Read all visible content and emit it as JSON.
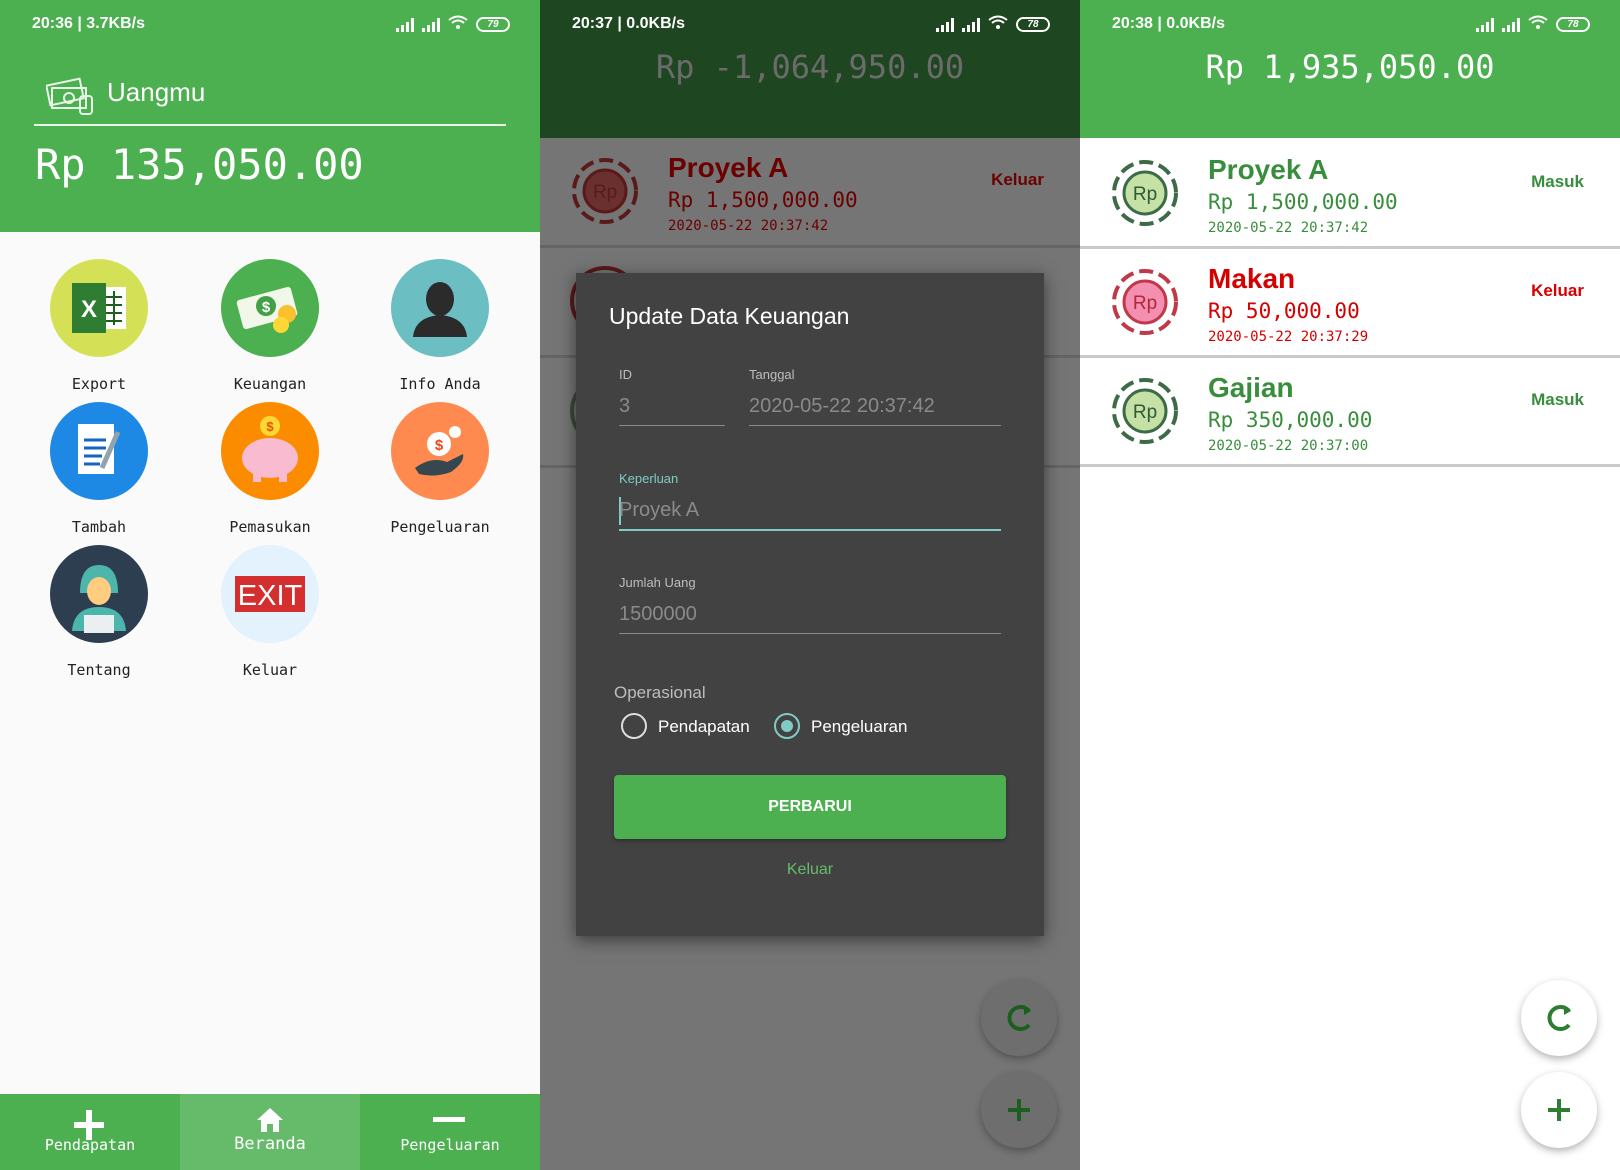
{
  "screen1": {
    "status": {
      "time": "20:36 | 3.7KB/s",
      "battery": "79"
    },
    "app_title": "Uangmu",
    "balance": "Rp 135,050.00",
    "menu": [
      {
        "label": "Export",
        "icon": "excel-icon"
      },
      {
        "label": "Keuangan",
        "icon": "money-icon"
      },
      {
        "label": "Info Anda",
        "icon": "user-icon"
      },
      {
        "label": "Tambah",
        "icon": "document-icon"
      },
      {
        "label": "Pemasukan",
        "icon": "piggy-bank-icon"
      },
      {
        "label": "Pengeluaran",
        "icon": "hand-coin-icon"
      },
      {
        "label": "Tentang",
        "icon": "developer-icon"
      },
      {
        "label": "Keluar",
        "icon": "exit-icon"
      }
    ],
    "bottom_nav": [
      {
        "label": "Pendapatan",
        "icon": "plus-icon"
      },
      {
        "label": "Beranda",
        "icon": "home-icon"
      },
      {
        "label": "Pengeluaran",
        "icon": "minus-icon"
      }
    ]
  },
  "screen2": {
    "status": {
      "time": "20:37 | 0.0KB/s",
      "battery": "78"
    },
    "total": "Rp -1,064,950.00",
    "row": {
      "name": "Proyek A",
      "amount": "Rp 1,500,000.00",
      "date": "2020-05-22 20:37:42",
      "type": "Keluar"
    },
    "dialog": {
      "title": "Update Data Keuangan",
      "id_label": "ID",
      "id_value": "3",
      "date_label": "Tanggal",
      "date_value": "2020-05-22 20:37:42",
      "purpose_label": "Keperluan",
      "purpose_value": "Proyek A",
      "amount_label": "Jumlah Uang",
      "amount_value": "1500000",
      "op_label": "Operasional",
      "op_options": [
        "Pendapatan",
        "Pengeluaran"
      ],
      "op_selected": "Pengeluaran",
      "update_button": "PERBARUI",
      "exit_button": "Keluar"
    }
  },
  "screen3": {
    "status": {
      "time": "20:38 | 0.0KB/s",
      "battery": "78"
    },
    "total": "Rp 1,935,050.00",
    "rows": [
      {
        "name": "Proyek A",
        "amount": "Rp 1,500,000.00",
        "date": "2020-05-22 20:37:42",
        "type": "Masuk"
      },
      {
        "name": "Makan",
        "amount": "Rp 50,000.00",
        "date": "2020-05-22 20:37:29",
        "type": "Keluar"
      },
      {
        "name": "Gajian",
        "amount": "Rp 350,000.00",
        "date": "2020-05-22 20:37:00",
        "type": "Masuk"
      }
    ]
  },
  "colors": {
    "primary": "#4caf50",
    "dark_header": "#1e4620",
    "income": "#388e3c",
    "expense": "#d50000",
    "accent": "#80cbc4"
  }
}
